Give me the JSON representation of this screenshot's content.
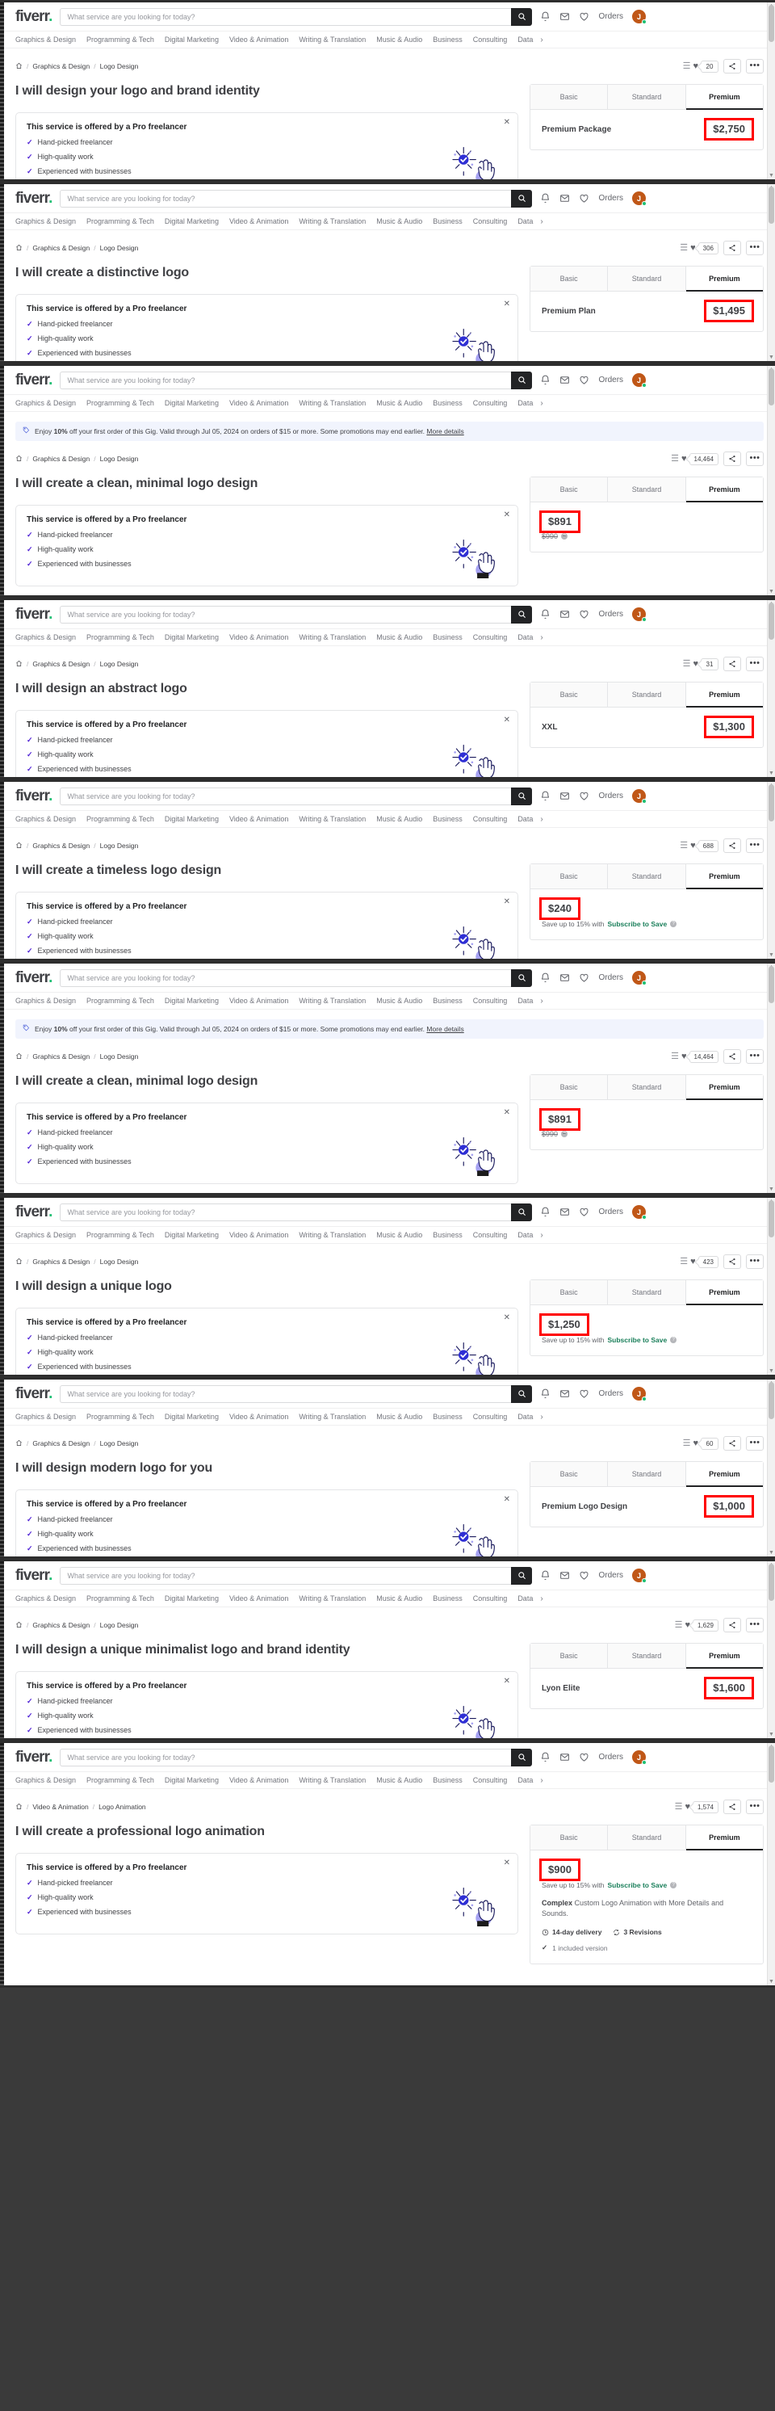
{
  "header": {
    "logo": "fiverr",
    "logo_dot": ".",
    "search_placeholder": "What service are you looking for today?",
    "search_value": "",
    "orders_label": "Orders",
    "avatar_initial": "J"
  },
  "categories": [
    "Graphics & Design",
    "Programming & Tech",
    "Digital Marketing",
    "Video & Animation",
    "Writing & Translation",
    "Music & Audio",
    "Business",
    "Consulting",
    "Data"
  ],
  "category_overflow_chevron": "›",
  "promo": {
    "prefix": "Enjoy ",
    "bold": "10%",
    "text": " off your first order of this Gig. Valid through Jul 05, 2024 on orders of $15 or more. Some promotions may end earlier. ",
    "link": "More details"
  },
  "price_tabs": [
    "Basic",
    "Standard",
    "Premium"
  ],
  "active_tab": "Premium",
  "pro_card": {
    "heading": "This service is offered by a Pro freelancer",
    "bullets": [
      "Hand-picked freelancer",
      "High-quality work",
      "Experienced with businesses"
    ],
    "close": "✕"
  },
  "subscribe_save": {
    "prefix": "Save up to 15% with ",
    "link": "Subscribe to Save"
  },
  "panels": [
    {
      "breadcrumb": [
        "Graphics & Design",
        "Logo Design"
      ],
      "favorites": "20",
      "title": "I will design your logo and brand identity",
      "package_name": "Premium Package",
      "price": "$2,750",
      "has_promo": false,
      "old_price": null,
      "show_subscribe": false
    },
    {
      "breadcrumb": [
        "Graphics & Design",
        "Logo Design"
      ],
      "favorites": "306",
      "title": "I will create a distinctive logo",
      "package_name": "Premium Plan",
      "price": "$1,495",
      "has_promo": false,
      "old_price": null,
      "show_subscribe": false
    },
    {
      "breadcrumb": [
        "Graphics & Design",
        "Logo Design"
      ],
      "favorites": "14,464",
      "title": "I will create a clean, minimal logo design",
      "package_name": "",
      "price": "$891",
      "has_promo": true,
      "old_price": "$990",
      "show_subscribe": false
    },
    {
      "breadcrumb": [
        "Graphics & Design",
        "Logo Design"
      ],
      "favorites": "31",
      "title": "I will design an abstract logo",
      "package_name": "XXL",
      "price": "$1,300",
      "has_promo": false,
      "old_price": null,
      "show_subscribe": false
    },
    {
      "breadcrumb": [
        "Graphics & Design",
        "Logo Design"
      ],
      "favorites": "688",
      "title": "I will create a timeless logo design",
      "package_name": "",
      "price": "$240",
      "has_promo": false,
      "old_price": null,
      "show_subscribe": true
    },
    {
      "breadcrumb": [
        "Graphics & Design",
        "Logo Design"
      ],
      "favorites": "14,464",
      "title": "I will create a clean, minimal logo design",
      "package_name": "",
      "price": "$891",
      "has_promo": true,
      "old_price": "$990",
      "show_subscribe": false
    },
    {
      "breadcrumb": [
        "Graphics & Design",
        "Logo Design"
      ],
      "favorites": "423",
      "title": "I will design a unique logo",
      "package_name": "",
      "price": "$1,250",
      "has_promo": false,
      "old_price": null,
      "show_subscribe": true
    },
    {
      "breadcrumb": [
        "Graphics & Design",
        "Logo Design"
      ],
      "favorites": "60",
      "title": "I will design modern logo for you",
      "package_name": "Premium Logo Design",
      "price": "$1,000",
      "has_promo": false,
      "old_price": null,
      "show_subscribe": false
    },
    {
      "breadcrumb": [
        "Graphics & Design",
        "Logo Design"
      ],
      "favorites": "1,629",
      "title": "I will design a unique minimalist logo and brand identity",
      "package_name": "Lyon Elite",
      "price": "$1,600",
      "has_promo": false,
      "old_price": null,
      "show_subscribe": false
    },
    {
      "breadcrumb": [
        "Video & Animation",
        "Logo Animation"
      ],
      "favorites": "1,574",
      "title": "I will create a professional logo animation",
      "package_name": "",
      "price": "$900",
      "has_promo": false,
      "old_price": null,
      "show_subscribe": true,
      "desc_bold": "Complex",
      "desc_rest": " Custom Logo Animation with More Details and Sounds.",
      "delivery": "14-day delivery",
      "revisions": "3 Revisions",
      "included": "1 included version"
    }
  ],
  "colors": {
    "brand_green": "#1dbf73",
    "highlight_red": "#ff0000",
    "dark": "#222325",
    "text": "#404145",
    "muted": "#74767e",
    "promo_bg": "#f1f4fd",
    "avatar": "#c05717",
    "subscribe_green": "#1a7f5a"
  }
}
